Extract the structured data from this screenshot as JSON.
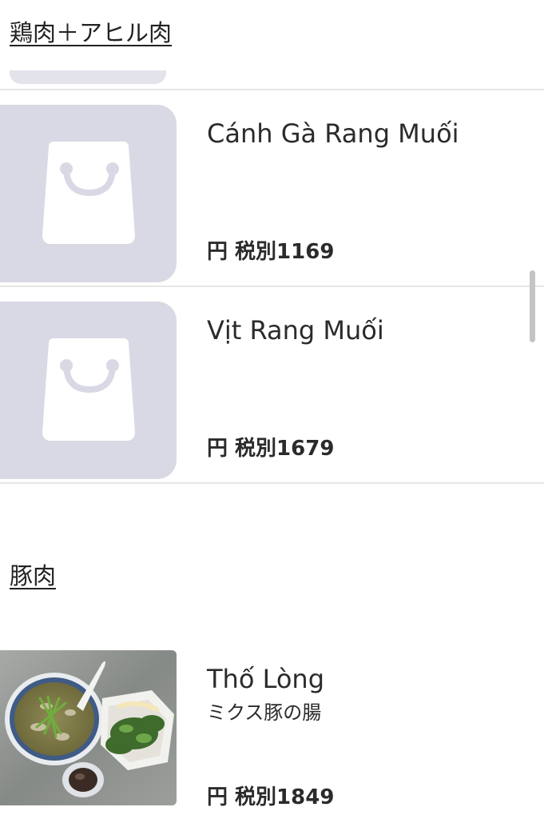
{
  "sections": [
    {
      "title": "鶏肉＋アヒル肉",
      "items": [
        {
          "name": "Cánh Gà Rang Muối",
          "price": "円 税別1169",
          "image": "shopping-bag-placeholder-icon"
        },
        {
          "name": "Vịt Rang Muối",
          "price": "円 税別1679",
          "image": "shopping-bag-placeholder-icon"
        }
      ]
    },
    {
      "title": "豚肉",
      "items": [
        {
          "name": "Thố Lòng",
          "description": "ミクス豚の腸",
          "price": "円 税別1849",
          "image": "food-photo"
        }
      ]
    }
  ],
  "colors": {
    "placeholder_bg": "#d9d9e5",
    "placeholder_icon": "#ffffff",
    "divider": "#e6e6e6",
    "text": "#2b2b2b"
  }
}
